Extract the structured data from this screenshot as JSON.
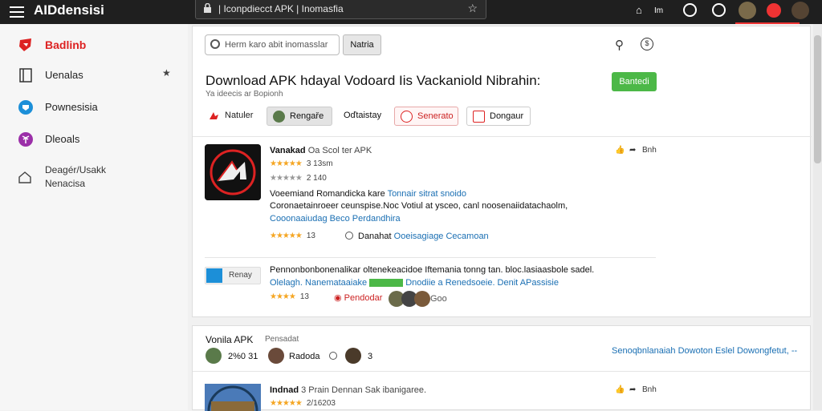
{
  "app": {
    "title": "AIDdensisi"
  },
  "urlbar": {
    "url": "| Iconpdiecct APK | Inomasfia"
  },
  "topbar": {
    "label": "Im"
  },
  "sidebar": {
    "items": [
      {
        "label": "Badlinb"
      },
      {
        "label": "Uenalas"
      },
      {
        "label": "Pownesisia"
      },
      {
        "label": "Dleoals"
      }
    ],
    "footer_line1": "Deagér/Usakk",
    "footer_line2": "Nenacisa"
  },
  "search": {
    "placeholder": "Herm karo abit inomasslar",
    "button": "Natria"
  },
  "headline": {
    "title": "Download APK hdayal Vodoard Iis Vackaniold Nibrahin:",
    "subtitle": "Ya ideecis ar Bopionh",
    "action": "Bantedi"
  },
  "chips": [
    {
      "label": "Natuler"
    },
    {
      "label": "Rengaře"
    },
    {
      "label": "Oďtaistay"
    },
    {
      "label": "Senerato"
    },
    {
      "label": "Dongaur"
    }
  ],
  "listing1": {
    "name": "Vanakad",
    "name_rest": "Oa Scol ter APK",
    "rating1": "3 13sm",
    "rating2": "2 140",
    "line1_a": "Voeemiand Romandicka kare",
    "line1_b": "Tonnair sitrat snoido",
    "line2": "Coronaetainroeer ceunspise.Noc Votiul at ysceo, canl noosenaiidatachaolm,",
    "line3": "Cooonaaiudag Beco Perdandhira",
    "rating3": "13",
    "meta_a": "Danahat",
    "meta_b": "Ooeisagiage Cecamoan",
    "like_count": "Bnh"
  },
  "listing2": {
    "badge": "Renay",
    "line1": "Pennonbonbonenalikar oltenekeacidoe Iftemania tonng tan. bloc.lasiaasbole sadel.",
    "line2_a": "Olelagh. Nanemataaiake",
    "line2_b": "Dnodiie a Renedsoeie. Denit APassisie",
    "rating": "13",
    "badge2": "Pendodar",
    "meta": "Goo"
  },
  "section2": {
    "title": "Vonila APK",
    "tag": "Pensadat",
    "stat1": "2%0 31",
    "stat2": "Radoda",
    "stat3": "3",
    "link": "Senoqbnlanaiah Dowoton Eslel Dowongfetut, --",
    "item_name": "Indnad",
    "item_rest": "3 Prain Dennan Sak ibanigaree.",
    "item_rating": "2/16203",
    "like_count": "Bnh"
  }
}
